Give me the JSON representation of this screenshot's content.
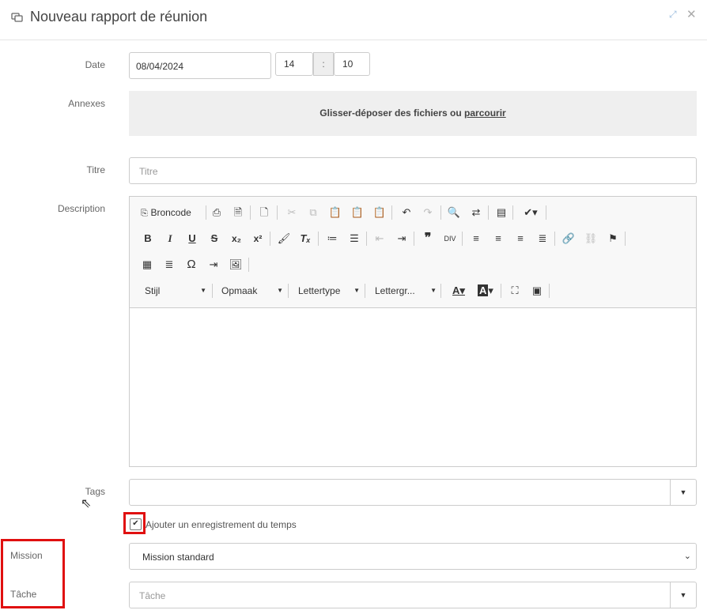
{
  "header": {
    "title": "Nouveau rapport de réunion",
    "expand_icon": "expand-icon",
    "close_icon": "close-icon",
    "title_icon": "chat-icon"
  },
  "form": {
    "date_label": "Date",
    "date_value": "08/04/2024",
    "hour_value": "14",
    "time_separator": ":",
    "minute_value": "10",
    "annexes_label": "Annexes",
    "dropzone_text": "Glisser-déposer des fichiers ou ",
    "dropzone_link": "parcourir",
    "titre_label": "Titre",
    "titre_placeholder": "Titre",
    "description_label": "Description",
    "tags_label": "Tags",
    "time_checkbox_label": "Ajouter un enregistrement du temps",
    "time_checkbox_checked": true,
    "mission_label": "Mission",
    "mission_value": "Mission standard",
    "tache_label": "Tâche",
    "tache_placeholder": "Tâche",
    "highlight_color": "#e01010"
  },
  "editor": {
    "source_label": "Broncode",
    "stijl_label": "Stijl",
    "opmaak_label": "Opmaak",
    "lettertype_label": "Lettertype",
    "lettergrootte_label": "Lettergr..."
  }
}
